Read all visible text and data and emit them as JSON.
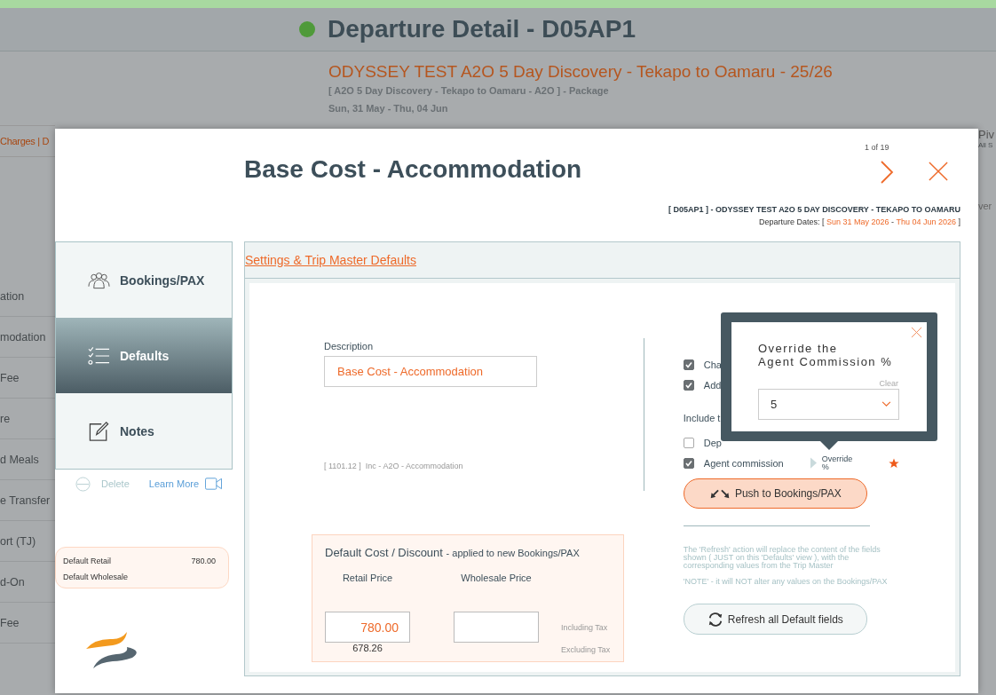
{
  "page_title": "Departure Detail - D05AP1",
  "trip": {
    "name": "ODYSSEY TEST  A2O 5 Day Discovery - Tekapo to Oamaru - 25/26",
    "package": "[ A2O 5 Day Discovery - Tekapo to Oamaru - A2O ] - Package",
    "dates": "Sun, 31 May  - Thu, 04 Jun"
  },
  "background_tabs": "Charges | D",
  "background_rows": [
    "ation",
    "modation",
    "Fee",
    "re",
    "d Meals",
    "e Transfer",
    "ort (TJ)",
    "d-On",
    "Fee"
  ],
  "background_right": {
    "title": "Piv",
    "subtitle": "All S",
    "row_text": "ver"
  },
  "modal": {
    "counter": "1 of 19",
    "title": "Base Cost - Accommodation",
    "trip_line": "[ D05AP1 ] - ODYSSEY TEST  A2O 5 DAY DISCOVERY - TEKAPO TO OAMARU",
    "departure_dates": {
      "label": "Departure Dates: [",
      "start": "Sun 31 May 2026",
      "separator": "-",
      "end": "Thu 04 Jun 2026",
      "close": "]"
    }
  },
  "side_tabs": [
    {
      "label": "Bookings/PAX",
      "selected": false
    },
    {
      "label": "Defaults",
      "selected": true
    },
    {
      "label": "Notes",
      "selected": false
    }
  ],
  "actions": {
    "delete": "Delete",
    "learn_more": "Learn More"
  },
  "defaults_summary": [
    {
      "label": "Default Retail",
      "value": "780.00"
    },
    {
      "label": "Default Wholesale"
    }
  ],
  "section_link": "Settings & Trip Master Defaults",
  "description": {
    "label": "Description",
    "value": "Base Cost - Accommodation"
  },
  "account_code": {
    "code": "[ 1101.12 ]",
    "name": "Inc - A2O - Accommodation"
  },
  "default_cost": {
    "title": "Default Cost / Discount",
    "subtitle": "- applied to new Bookings/PAX",
    "retail_label": "Retail Price",
    "wholesale_label": "Wholesale Price",
    "retail_value": "780.00",
    "retail_ex_tax": "678.26",
    "including_tax": "Including Tax",
    "excluding_tax": "Excluding Tax"
  },
  "options": [
    {
      "label": "Cha",
      "checked": true
    },
    {
      "label": "Add",
      "checked": true
    }
  ],
  "include_label": "Include t",
  "include_options": [
    {
      "label": "Dep",
      "checked": false
    },
    {
      "label": "Agent commission",
      "checked": true,
      "override": "Override %"
    }
  ],
  "push_button": "Push to Bookings/PAX",
  "refresh_info": [
    "The 'Refresh' action will replace the content of the fields shown ( JUST on this 'Defaults' view ), with the corresponding values from the Trip Master",
    "'NOTE' - it will NOT alter any values on the Bookings/PAX"
  ],
  "refresh_button": "Refresh all Default fields",
  "popover": {
    "title_lines": [
      "Override the",
      "Agent Commission %"
    ],
    "clear": "Clear",
    "value": "5"
  }
}
